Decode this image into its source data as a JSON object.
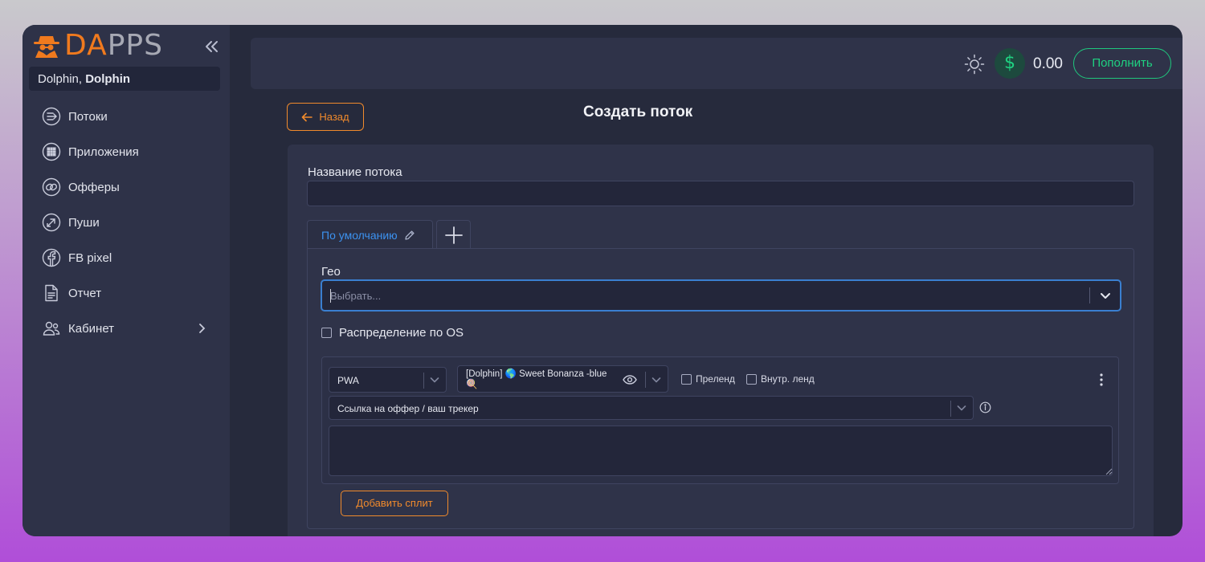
{
  "app": {
    "logo_part1": "DA",
    "logo_part2": "PPS",
    "brand_color": "#f07a1e"
  },
  "user": {
    "first": "Dolphin,",
    "second": "Dolphin"
  },
  "sidebar": {
    "items": [
      {
        "label": "Потоки",
        "icon": "streams-icon"
      },
      {
        "label": "Приложения",
        "icon": "apps-grid-icon"
      },
      {
        "label": "Офферы",
        "icon": "link-icon"
      },
      {
        "label": "Пуши",
        "icon": "push-icon"
      },
      {
        "label": "FB pixel",
        "icon": "facebook-icon"
      },
      {
        "label": "Отчет",
        "icon": "report-icon"
      },
      {
        "label": "Кабинет",
        "icon": "users-icon"
      }
    ]
  },
  "topbar": {
    "currency_symbol": "$",
    "balance": "0.00",
    "topup_label": "Пополнить",
    "accent_color": "#1fd181"
  },
  "page": {
    "back_label": "Назад",
    "title": "Создать поток"
  },
  "form": {
    "name_label": "Название потока",
    "name_value": "",
    "tabs": [
      {
        "label": "По умолчанию",
        "active": true
      }
    ],
    "geo_label": "Гео",
    "geo_placeholder": "Выбрать...",
    "os_distribution_label": "Распределение по OS",
    "os_distribution_checked": false,
    "split": {
      "type_value": "PWA",
      "app_value_line1": "[Dolphin] 🌎 Sweet Bonanza -blue",
      "app_value_line2": "🍭",
      "preland_label": "Преленд",
      "inner_land_label": "Внутр. ленд",
      "offer_link_placeholder": "Ссылка на оффер / ваш трекер",
      "textarea_value": ""
    },
    "add_split_label": "Добавить сплит"
  }
}
